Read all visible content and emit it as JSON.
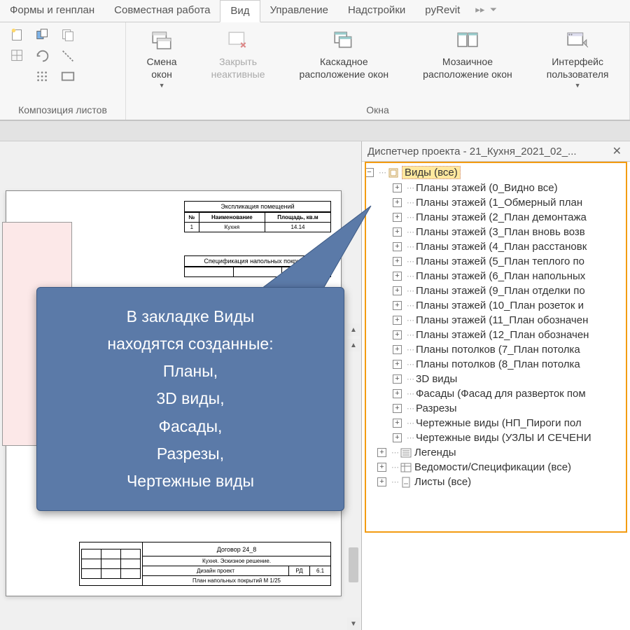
{
  "tabs": [
    "Формы и генплан",
    "Совместная работа",
    "Вид",
    "Управление",
    "Надстройки",
    "pyRevit"
  ],
  "activeTab": 2,
  "ribbon": {
    "group1_label": "Композиция листов",
    "group2_label": "Окна",
    "switch_windows": "Смена\nокон",
    "close_inactive": "Закрыть\nнеактивные",
    "cascade": "Каскадное\nрасположение окон",
    "tile": "Мозаичное\nрасположение окон",
    "ui": "Интерфейс\nпользователя"
  },
  "panel": {
    "title": "Диспетчер проекта - 21_Кухня_2021_02_...",
    "root": "Виды (все)",
    "children": [
      "Планы этажей (0_Видно все)",
      "Планы этажей (1_Обмерный план",
      "Планы этажей (2_План демонтажа",
      "Планы этажей (3_План вновь возв",
      "Планы этажей (4_План расстановк",
      "Планы этажей (5_План теплого по",
      "Планы этажей (6_План напольных",
      "Планы этажей (9_План отделки по",
      "Планы этажей (10_План розеток и",
      "Планы этажей (11_План обозначен",
      "Планы этажей (12_План обозначен",
      "Планы потолков (7_План потолка",
      "Планы потолков (8_План потолка",
      "3D виды",
      "Фасады (Фасад для разверток пом",
      "Разрезы",
      "Чертежные виды (НП_Пироги пол",
      "Чертежные виды (УЗЛЫ И СЕЧЕНИ"
    ],
    "siblings": [
      "Легенды",
      "Ведомости/Спецификации (все)",
      "Листы (все)"
    ]
  },
  "callout": {
    "l1": "В закладке Виды",
    "l2": "находятся созданные:",
    "l3": "Планы,",
    "l4": "3D виды,",
    "l5": "Фасады,",
    "l6": "Разрезы,",
    "l7": "Чертежные виды"
  },
  "doc": {
    "sched1_title": "Экспликация помещений",
    "sched1_h1": "№",
    "sched1_h2": "Наименование",
    "sched1_h3": "Площадь, кв.м",
    "sched1_r1": "1",
    "sched1_r2": "Кухня",
    "sched1_r3": "14.14",
    "sched2_title": "Спецификация напольных покрытий",
    "tb_contract": "Договор 24_8",
    "tb_subtitle": "Кухня. Эскизное решение.",
    "tb_design": "Дизайн проект",
    "tb_stage": "РД",
    "tb_sheet": "6.1",
    "tb_drawing": "План напольных покрытий М 1/25"
  }
}
